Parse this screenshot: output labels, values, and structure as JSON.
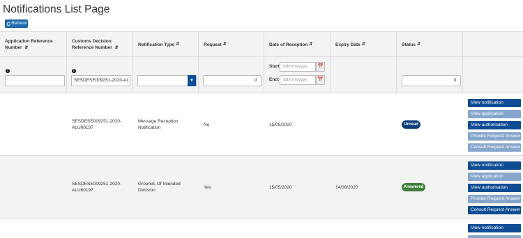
{
  "page": {
    "title": "Notifications List Page"
  },
  "toolbar": {
    "refresh_label": "Refresh"
  },
  "columns": [
    {
      "label": "Application Reference Number"
    },
    {
      "label": "Customs Decision Reference Number"
    },
    {
      "label": "Notification Type"
    },
    {
      "label": "Request"
    },
    {
      "label": "Date of Reception"
    },
    {
      "label": "Expiry Date"
    },
    {
      "label": "Status"
    }
  ],
  "sort_icon": "sort-icon",
  "filters": {
    "info_icon_glyph": "i",
    "application_reference_value": "",
    "customs_decision_value": "SESDESE009251-2020-AL",
    "notification_type_value": "",
    "request_value": "",
    "date_start_label": "Start:",
    "date_end_label": "End:",
    "date_placeholder": "dd/mm/yyyy",
    "status_value": ""
  },
  "rows": [
    {
      "application_reference": "",
      "customs_decision": "SESDESE009251-2020-ALU60197",
      "notification_type": "Message Reception Notification",
      "request": "No",
      "date_of_reception": "15/05/2020",
      "expiry_date": "",
      "status": "Unread",
      "actions": [
        "View notification",
        "View application",
        "View authorisation",
        "Provide Request Answer",
        "Consult Request Answer"
      ]
    },
    {
      "application_reference": "",
      "customs_decision": "SESDESE009251-2020-ALU60197",
      "notification_type": "Grounds Of Intended Decision",
      "request": "Yes",
      "date_of_reception": "15/05/2020",
      "expiry_date": "14/06/2020",
      "status": "Answered",
      "actions": [
        "View notification",
        "View application",
        "View authorisation",
        "Provide Request Answer",
        "Consult Request Answer"
      ]
    },
    {
      "actions": [
        "View notification"
      ]
    }
  ],
  "colors": {
    "primary_button": "#0e4c94",
    "disabled_button": "#86a6cc",
    "unread_badge": "#0b3d7a",
    "answered_badge": "#3f7f3a"
  }
}
